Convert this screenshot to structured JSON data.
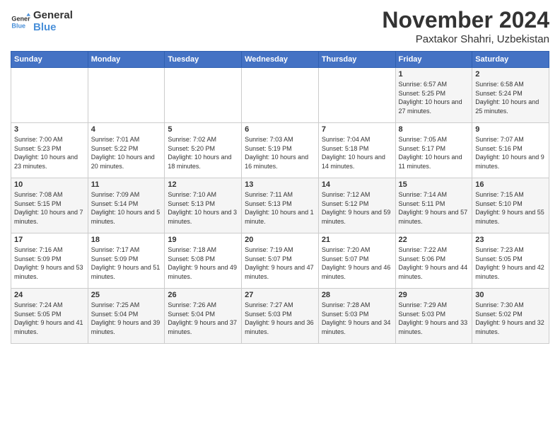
{
  "logo": {
    "line1": "General",
    "line2": "Blue"
  },
  "title": "November 2024",
  "subtitle": "Paxtakor Shahri, Uzbekistan",
  "days_header": [
    "Sunday",
    "Monday",
    "Tuesday",
    "Wednesday",
    "Thursday",
    "Friday",
    "Saturday"
  ],
  "weeks": [
    [
      {
        "day": "",
        "info": ""
      },
      {
        "day": "",
        "info": ""
      },
      {
        "day": "",
        "info": ""
      },
      {
        "day": "",
        "info": ""
      },
      {
        "day": "",
        "info": ""
      },
      {
        "day": "1",
        "info": "Sunrise: 6:57 AM\nSunset: 5:25 PM\nDaylight: 10 hours and 27 minutes."
      },
      {
        "day": "2",
        "info": "Sunrise: 6:58 AM\nSunset: 5:24 PM\nDaylight: 10 hours and 25 minutes."
      }
    ],
    [
      {
        "day": "3",
        "info": "Sunrise: 7:00 AM\nSunset: 5:23 PM\nDaylight: 10 hours and 23 minutes."
      },
      {
        "day": "4",
        "info": "Sunrise: 7:01 AM\nSunset: 5:22 PM\nDaylight: 10 hours and 20 minutes."
      },
      {
        "day": "5",
        "info": "Sunrise: 7:02 AM\nSunset: 5:20 PM\nDaylight: 10 hours and 18 minutes."
      },
      {
        "day": "6",
        "info": "Sunrise: 7:03 AM\nSunset: 5:19 PM\nDaylight: 10 hours and 16 minutes."
      },
      {
        "day": "7",
        "info": "Sunrise: 7:04 AM\nSunset: 5:18 PM\nDaylight: 10 hours and 14 minutes."
      },
      {
        "day": "8",
        "info": "Sunrise: 7:05 AM\nSunset: 5:17 PM\nDaylight: 10 hours and 11 minutes."
      },
      {
        "day": "9",
        "info": "Sunrise: 7:07 AM\nSunset: 5:16 PM\nDaylight: 10 hours and 9 minutes."
      }
    ],
    [
      {
        "day": "10",
        "info": "Sunrise: 7:08 AM\nSunset: 5:15 PM\nDaylight: 10 hours and 7 minutes."
      },
      {
        "day": "11",
        "info": "Sunrise: 7:09 AM\nSunset: 5:14 PM\nDaylight: 10 hours and 5 minutes."
      },
      {
        "day": "12",
        "info": "Sunrise: 7:10 AM\nSunset: 5:13 PM\nDaylight: 10 hours and 3 minutes."
      },
      {
        "day": "13",
        "info": "Sunrise: 7:11 AM\nSunset: 5:13 PM\nDaylight: 10 hours and 1 minute."
      },
      {
        "day": "14",
        "info": "Sunrise: 7:12 AM\nSunset: 5:12 PM\nDaylight: 9 hours and 59 minutes."
      },
      {
        "day": "15",
        "info": "Sunrise: 7:14 AM\nSunset: 5:11 PM\nDaylight: 9 hours and 57 minutes."
      },
      {
        "day": "16",
        "info": "Sunrise: 7:15 AM\nSunset: 5:10 PM\nDaylight: 9 hours and 55 minutes."
      }
    ],
    [
      {
        "day": "17",
        "info": "Sunrise: 7:16 AM\nSunset: 5:09 PM\nDaylight: 9 hours and 53 minutes."
      },
      {
        "day": "18",
        "info": "Sunrise: 7:17 AM\nSunset: 5:09 PM\nDaylight: 9 hours and 51 minutes."
      },
      {
        "day": "19",
        "info": "Sunrise: 7:18 AM\nSunset: 5:08 PM\nDaylight: 9 hours and 49 minutes."
      },
      {
        "day": "20",
        "info": "Sunrise: 7:19 AM\nSunset: 5:07 PM\nDaylight: 9 hours and 47 minutes."
      },
      {
        "day": "21",
        "info": "Sunrise: 7:20 AM\nSunset: 5:07 PM\nDaylight: 9 hours and 46 minutes."
      },
      {
        "day": "22",
        "info": "Sunrise: 7:22 AM\nSunset: 5:06 PM\nDaylight: 9 hours and 44 minutes."
      },
      {
        "day": "23",
        "info": "Sunrise: 7:23 AM\nSunset: 5:05 PM\nDaylight: 9 hours and 42 minutes."
      }
    ],
    [
      {
        "day": "24",
        "info": "Sunrise: 7:24 AM\nSunset: 5:05 PM\nDaylight: 9 hours and 41 minutes."
      },
      {
        "day": "25",
        "info": "Sunrise: 7:25 AM\nSunset: 5:04 PM\nDaylight: 9 hours and 39 minutes."
      },
      {
        "day": "26",
        "info": "Sunrise: 7:26 AM\nSunset: 5:04 PM\nDaylight: 9 hours and 37 minutes."
      },
      {
        "day": "27",
        "info": "Sunrise: 7:27 AM\nSunset: 5:03 PM\nDaylight: 9 hours and 36 minutes."
      },
      {
        "day": "28",
        "info": "Sunrise: 7:28 AM\nSunset: 5:03 PM\nDaylight: 9 hours and 34 minutes."
      },
      {
        "day": "29",
        "info": "Sunrise: 7:29 AM\nSunset: 5:03 PM\nDaylight: 9 hours and 33 minutes."
      },
      {
        "day": "30",
        "info": "Sunrise: 7:30 AM\nSunset: 5:02 PM\nDaylight: 9 hours and 32 minutes."
      }
    ]
  ]
}
